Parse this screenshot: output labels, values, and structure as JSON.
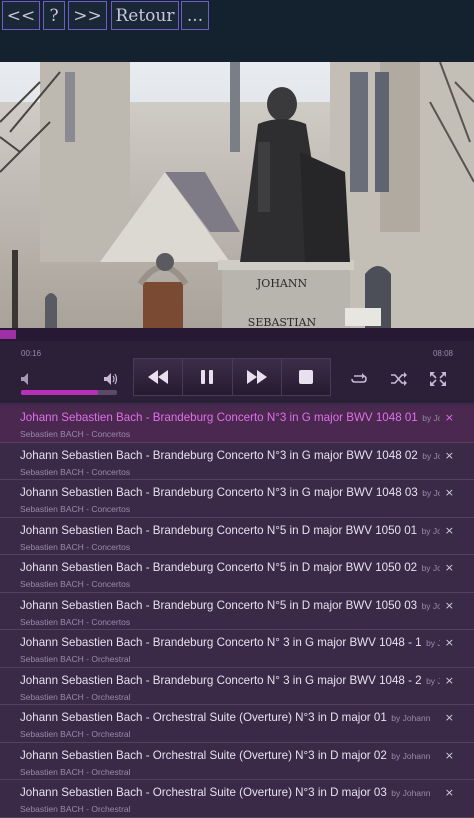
{
  "nav": {
    "prev_label": "<<",
    "help_label": "?",
    "next_label": ">>",
    "back_label": "Retour",
    "more_label": "..."
  },
  "player": {
    "elapsed": "00:16",
    "duration": "08:08",
    "progress": 0.033,
    "volume": 0.8,
    "controls": {
      "rewind_icon": "rewind-icon",
      "pause_icon": "pause-icon",
      "forward_icon": "fast-forward-icon",
      "stop_icon": "stop-icon",
      "repeat_icon": "repeat-icon",
      "shuffle_icon": "shuffle-icon",
      "fullscreen_icon": "fullscreen-icon"
    },
    "accent": "#a030a8"
  },
  "playlist": [
    {
      "title": "Johann Sebastien Bach - Brandeburg Concerto N°3 in G major BWV 1048 01",
      "by": "by Johann",
      "album": "Sebastien BACH - Concertos",
      "active": true
    },
    {
      "title": "Johann Sebastien Bach - Brandeburg Concerto N°3 in G major BWV 1048 02",
      "by": "by Johann",
      "album": "Sebastien BACH - Concertos"
    },
    {
      "title": "Johann Sebastien Bach - Brandeburg Concerto N°3 in G major BWV 1048 03",
      "by": "by Johann",
      "album": "Sebastien BACH - Concertos"
    },
    {
      "title": "Johann Sebastien Bach - Brandeburg Concerto N°5 in D major BWV 1050 01",
      "by": "by Johann",
      "album": "Sebastien BACH - Concertos"
    },
    {
      "title": "Johann Sebastien Bach - Brandeburg Concerto N°5 in D major BWV 1050 02",
      "by": "by Johann",
      "album": "Sebastien BACH - Concertos"
    },
    {
      "title": "Johann Sebastien Bach - Brandeburg Concerto N°5 in D major BWV 1050 03",
      "by": "by Johann",
      "album": "Sebastien BACH - Concertos"
    },
    {
      "title": "Johann Sebastien Bach - Brandeburg Concerto N° 3 in G major BWV 1048 - 1",
      "by": "by Johann",
      "album": "Sebastien BACH - Orchestral"
    },
    {
      "title": "Johann Sebastien Bach - Brandeburg Concerto N° 3 in G major BWV 1048 - 2",
      "by": "by Johann",
      "album": "Sebastien BACH - Orchestral"
    },
    {
      "title": "Johann Sebastien Bach - Orchestral Suite (Overture) N°3 in D major 01",
      "by": "by Johann",
      "album": "Sebastien BACH - Orchestral"
    },
    {
      "title": "Johann Sebastien Bach - Orchestral Suite (Overture) N°3 in D major 02",
      "by": "by Johann",
      "album": "Sebastien BACH - Orchestral"
    },
    {
      "title": "Johann Sebastien Bach - Orchestral Suite (Overture) N°3 in D major 03",
      "by": "by Johann",
      "album": "Sebastien BACH - Orchestral"
    }
  ],
  "remove_symbol": "×",
  "video": {
    "plaque_line1": "JOHANN",
    "plaque_line2": "SEBASTIAN"
  }
}
